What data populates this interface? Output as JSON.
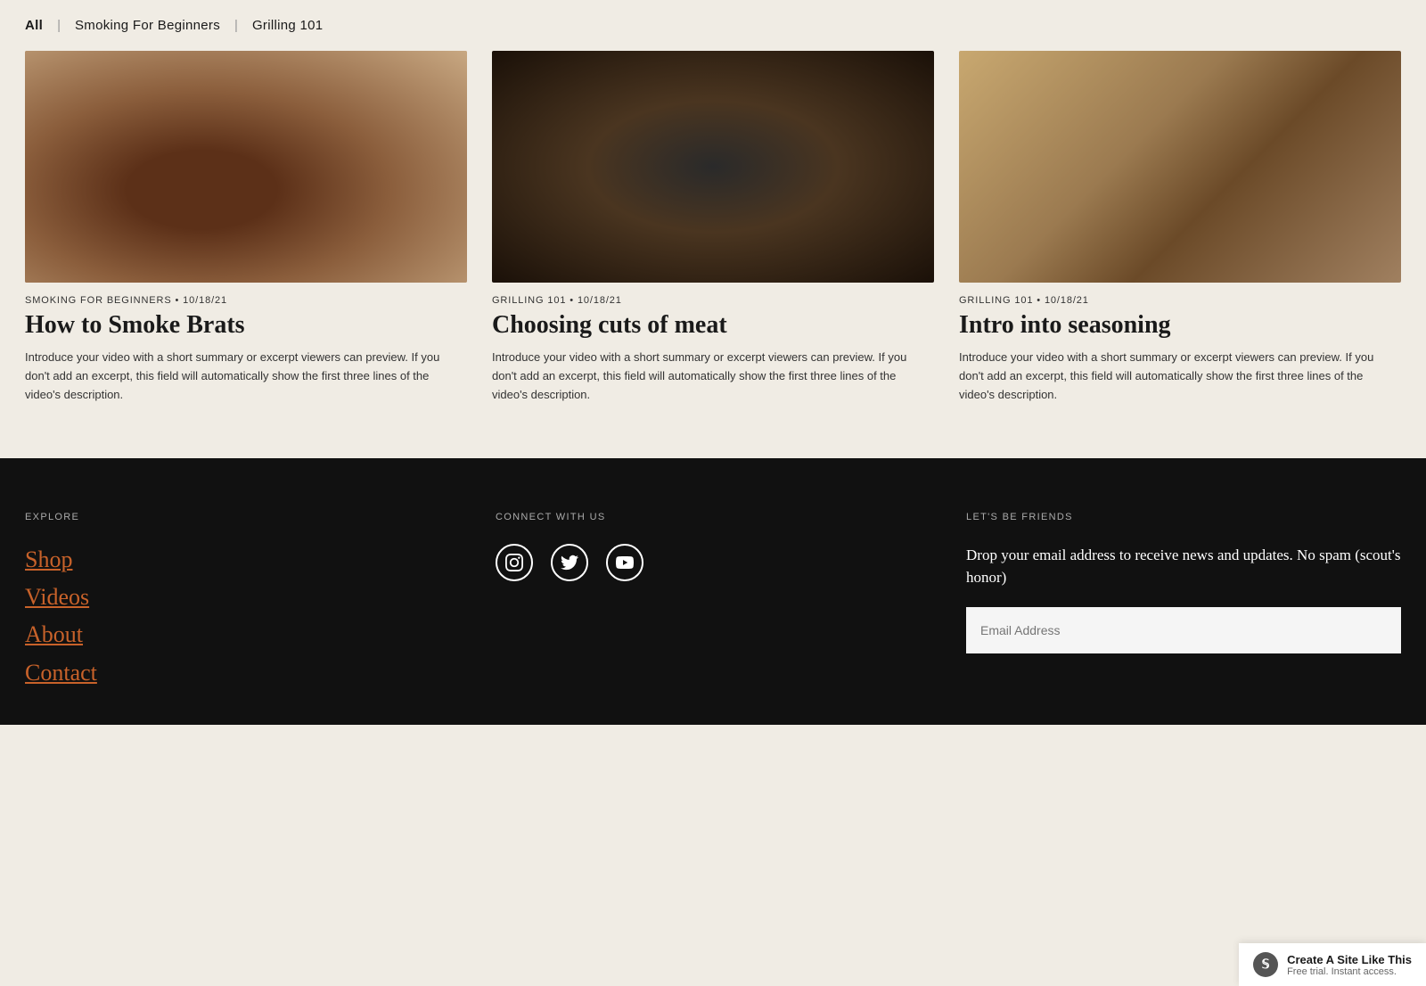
{
  "filter": {
    "all_label": "All",
    "sep1": "|",
    "smoking_label": "Smoking For Beginners",
    "sep2": "|",
    "grilling_label": "Grilling 101"
  },
  "cards": [
    {
      "category": "SMOKING FOR BEGINNERS",
      "date": "10/18/21",
      "title": "How to Smoke Brats",
      "excerpt": "Introduce your video with a short summary or excerpt viewers can preview. If you don't add an excerpt, this field will automatically show the first three lines of the video's description.",
      "img_class": "img-sausage"
    },
    {
      "category": "GRILLING 101",
      "date": "10/18/21",
      "title": "Choosing cuts of meat",
      "excerpt": "Introduce your video with a short summary or excerpt viewers can preview. If you don't add an excerpt, this field will automatically show the first three lines of the video's description.",
      "img_class": "img-meat"
    },
    {
      "category": "GRILLING 101",
      "date": "10/18/21",
      "title": "Intro into seasoning",
      "excerpt": "Introduce your video with a short summary or excerpt viewers can preview. If you don't add an excerpt, this field will automatically show the first three lines of the video's description.",
      "img_class": "img-seasoning"
    }
  ],
  "footer": {
    "explore_label": "EXPLORE",
    "links": [
      "Shop",
      "Videos",
      "About",
      "Contact"
    ],
    "connect_label": "CONNECT WITH US",
    "friends_label": "LET'S BE FRIENDS",
    "friends_text": "Drop your email address to receive news and updates. No spam (scout's honor)",
    "email_placeholder": "Email Address"
  },
  "badge": {
    "title": "Create A Site Like This",
    "subtitle": "Free trial. Instant access."
  }
}
